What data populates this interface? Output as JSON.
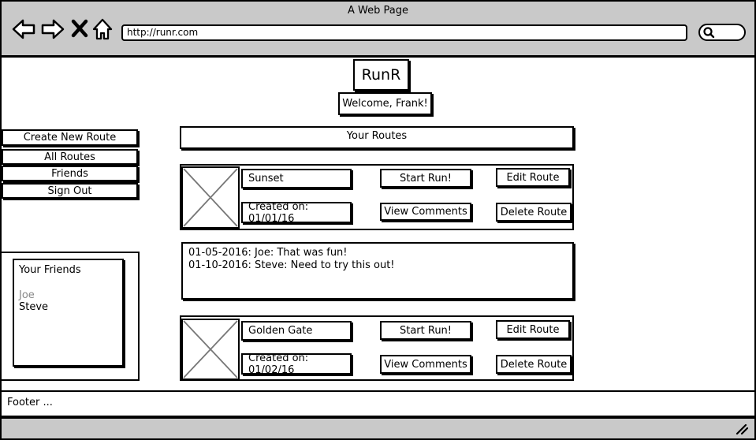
{
  "window": {
    "title": "A Web Page"
  },
  "browser": {
    "url": "http://runr.com",
    "back_icon": "arrow-left-icon",
    "forward_icon": "arrow-right-icon",
    "stop_icon": "close-icon",
    "home_icon": "home-icon",
    "search_icon": "search-icon"
  },
  "header": {
    "logo": "RunR",
    "welcome": "Welcome, Frank!"
  },
  "sidebar": {
    "items": [
      {
        "label": "Create New Route"
      },
      {
        "label": "All Routes"
      },
      {
        "label": "Friends"
      },
      {
        "label": "Sign Out"
      }
    ]
  },
  "friends_panel": {
    "title": "Your Friends",
    "friends": [
      "Joe",
      "Steve"
    ]
  },
  "main": {
    "section_title": "Your Routes",
    "routes": [
      {
        "name": "Sunset",
        "created": "Created on: 01/01/16",
        "start_label": "Start Run!",
        "comments_label": "View Comments",
        "edit_label": "Edit Route",
        "delete_label": "Delete Route"
      },
      {
        "name": "Golden Gate",
        "created": "Created on: 01/02/16",
        "start_label": "Start Run!",
        "comments_label": "View Comments",
        "edit_label": "Edit Route",
        "delete_label": "Delete Route"
      }
    ],
    "comments": [
      "01-05-2016: Joe: That was fun!",
      "01-10-2016: Steve: Need to try this out!"
    ]
  },
  "footer": {
    "text": "Footer ..."
  }
}
